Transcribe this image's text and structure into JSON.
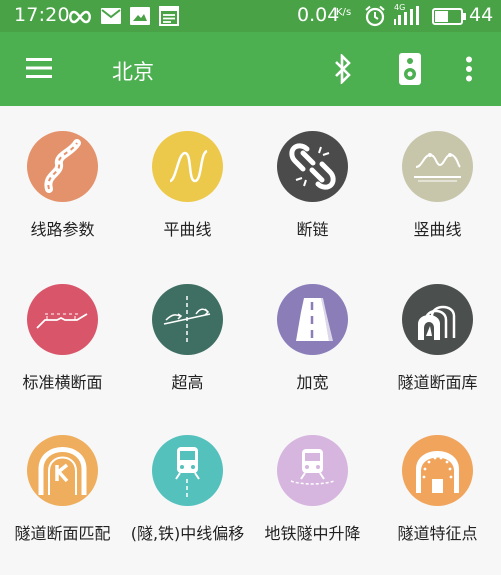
{
  "status_bar": {
    "time": "17:20",
    "speed": "0.04",
    "speed_unit_top": "K/",
    "speed_unit_bottom": "s",
    "network_label": "4G",
    "battery_level": "44",
    "icons": [
      "loop-icon",
      "mail-icon",
      "image-icon",
      "notes-icon",
      "alarm-icon",
      "signal-icon",
      "battery-icon"
    ]
  },
  "toolbar": {
    "title": "北京",
    "icons": [
      "menu-icon",
      "bluetooth-icon",
      "speaker-icon",
      "more-vert-icon"
    ]
  },
  "grid": {
    "items": [
      {
        "label": "线路参数",
        "color": "#e4926b",
        "icon": "winding-road-icon"
      },
      {
        "label": "平曲线",
        "color": "#ecc94b",
        "icon": "wave-curve-icon"
      },
      {
        "label": "断链",
        "color": "#4b4b4b",
        "icon": "broken-link-icon"
      },
      {
        "label": "竖曲线",
        "color": "#c7c6ab",
        "icon": "vertical-curve-icon"
      },
      {
        "label": "标准横断面",
        "color": "#d9556a",
        "icon": "cross-section-icon"
      },
      {
        "label": "超高",
        "color": "#3f6f62",
        "icon": "superelevation-icon"
      },
      {
        "label": "加宽",
        "color": "#8a7db8",
        "icon": "widening-road-icon"
      },
      {
        "label": "隧道断面库",
        "color": "#4b4f4d",
        "icon": "tunnel-library-icon"
      },
      {
        "label": "隧道断面匹配",
        "color": "#eeae5d",
        "icon": "tunnel-match-icon"
      },
      {
        "label": "(隧,铁)中线偏移",
        "color": "#54c1bd",
        "icon": "train-offset-icon"
      },
      {
        "label": "地铁隧中升降",
        "color": "#d6b5df",
        "icon": "metro-train-icon"
      },
      {
        "label": "隧道特征点",
        "color": "#f0a45c",
        "icon": "tunnel-feature-icon"
      }
    ]
  }
}
